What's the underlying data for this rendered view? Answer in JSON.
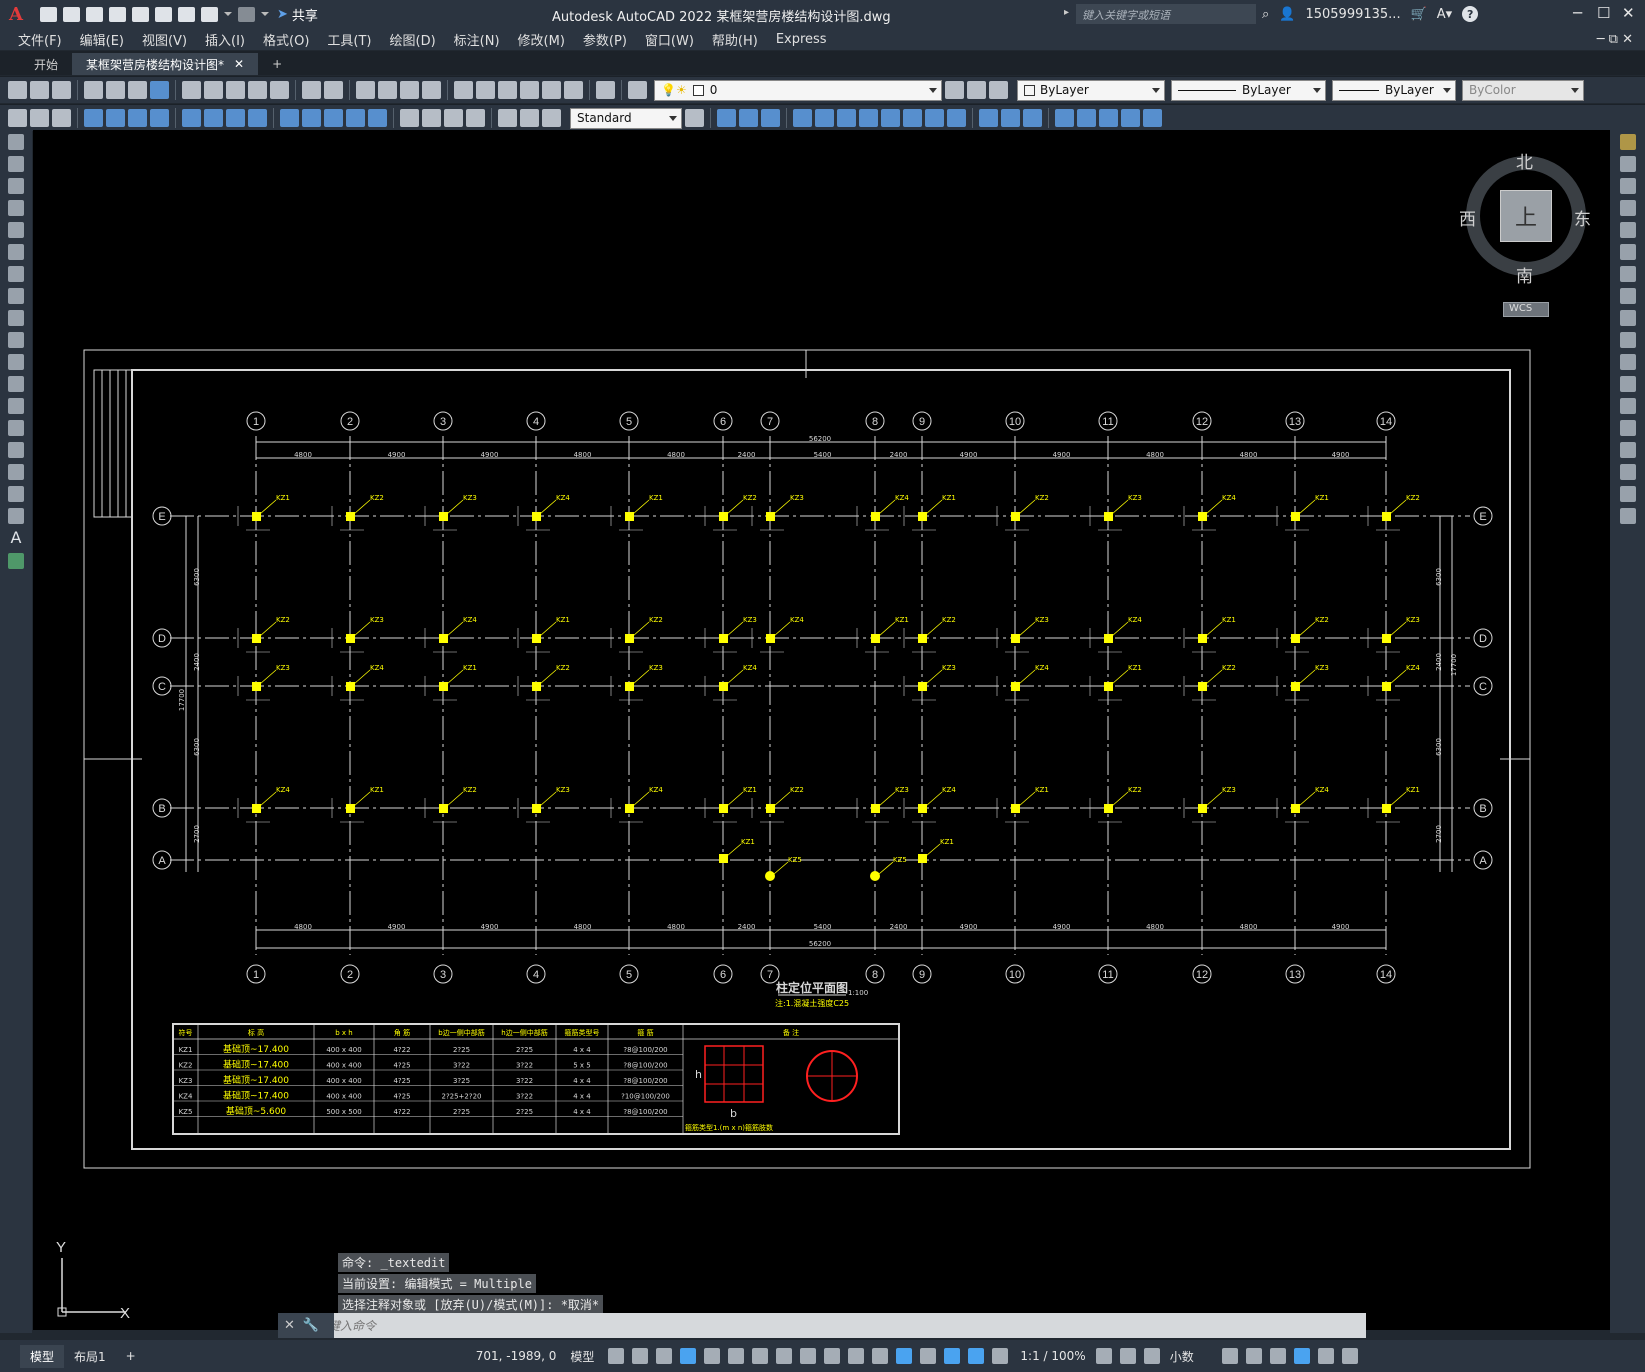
{
  "app": {
    "title": "Autodesk AutoCAD 2022    某框架营房楼结构设计图.dwg",
    "share_label": "共享",
    "search_placeholder": "键入关键字或短语",
    "user": "1505999135...",
    "logo": "A"
  },
  "menu": [
    "文件(F)",
    "编辑(E)",
    "视图(V)",
    "插入(I)",
    "格式(O)",
    "工具(T)",
    "绘图(D)",
    "标注(N)",
    "修改(M)",
    "参数(P)",
    "窗口(W)",
    "帮助(H)",
    "Express"
  ],
  "tabs": {
    "start": "开始",
    "doc": "某框架营房楼结构设计图*",
    "add": "+"
  },
  "props": {
    "layer": "0",
    "color": "ByLayer",
    "linetype": "ByLayer",
    "lineweight": "ByLayer",
    "plotstyle": "ByColor",
    "textstyle": "Standard"
  },
  "viewcube": {
    "north": "北",
    "south": "南",
    "east": "东",
    "west": "西",
    "top": "上",
    "wcs": "WCS"
  },
  "drawing": {
    "grid_numbers": [
      "1",
      "2",
      "3",
      "4",
      "5",
      "6",
      "7",
      "8",
      "9",
      "10",
      "11",
      "12",
      "13",
      "14"
    ],
    "grid_letters": [
      "E",
      "D",
      "C",
      "B",
      "A"
    ],
    "title": "柱定位平面图",
    "scale": "1:100",
    "subtitle": "注:1.混凝土强度C25",
    "total_dim": "56200",
    "spans": [
      "4800",
      "4900",
      "4900",
      "4800",
      "4800",
      "2400",
      "5400",
      "2400",
      "4900",
      "4900",
      "4800",
      "4800",
      "4900"
    ],
    "vdims": [
      "6300",
      "2400",
      "6300",
      "2700",
      "17700"
    ],
    "table_headers": [
      "符号",
      "标 高",
      "b x h",
      "角 筋",
      "b边一侧中部筋",
      "h边一侧中部筋",
      "箍筋类型号",
      "箍 筋",
      "备 注"
    ],
    "table_rows": [
      [
        "KZ1",
        "基础顶~17.400",
        "400 x 400",
        "4?22",
        "2?25",
        "2?25",
        "4 x 4",
        "?8@100/200"
      ],
      [
        "KZ2",
        "基础顶~17.400",
        "400 x 400",
        "4?25",
        "3?22",
        "3?22",
        "5 x 5",
        "?8@100/200"
      ],
      [
        "KZ3",
        "基础顶~17.400",
        "400 x 400",
        "4?25",
        "3?25",
        "3?22",
        "4 x 4",
        "?8@100/200"
      ],
      [
        "KZ4",
        "基础顶~17.400",
        "400 x 400",
        "4?25",
        "2?25+2?20",
        "3?22",
        "4 x 4",
        "?10@100/200"
      ],
      [
        "KZ5",
        "基础顶~5.600",
        "500 x 500",
        "4?22",
        "2?25",
        "2?25",
        "4 x 4",
        "?8@100/200"
      ]
    ],
    "legend_note": "箍筋类型1.(m x n)箍筋肢数",
    "legend_h": "h",
    "legend_b": "b"
  },
  "ucs": {
    "x": "X",
    "y": "Y"
  },
  "command": {
    "history": [
      "命令: _textedit",
      "当前设置: 编辑模式 = Multiple",
      "选择注释对象或 [放弃(U)/模式(M)]: *取消*"
    ],
    "placeholder": "键入命令"
  },
  "status": {
    "model_tab": "模型",
    "layout_tab": "布局1",
    "coords": "701, -1989, 0",
    "space": "模型",
    "scale": "1:1 / 100%",
    "units": "小数"
  }
}
